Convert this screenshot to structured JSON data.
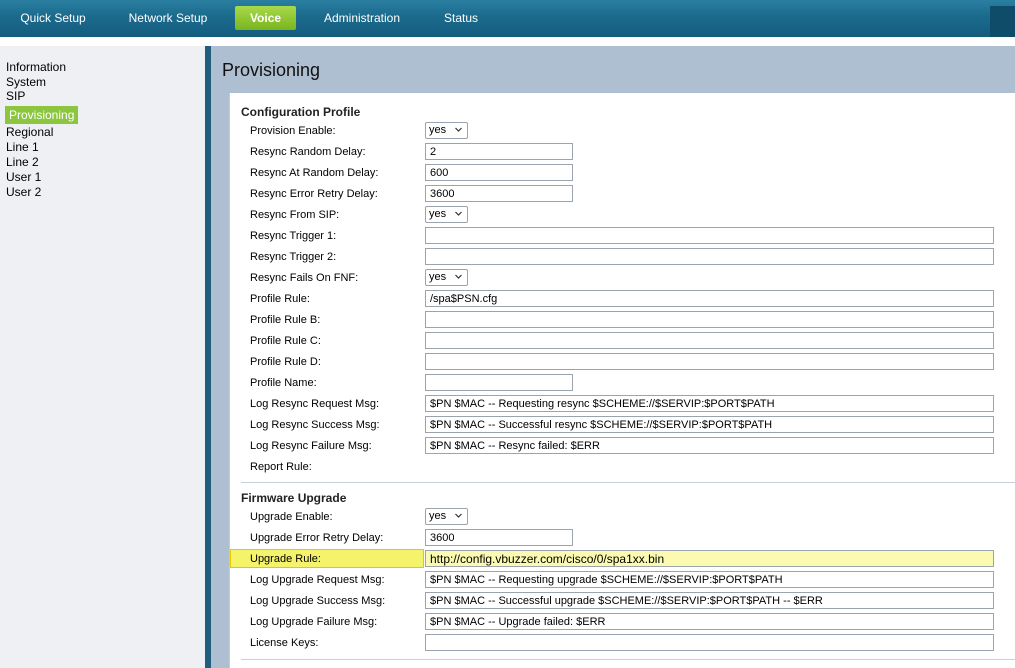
{
  "nav": {
    "tabs": [
      {
        "label": "Quick Setup"
      },
      {
        "label": "Network Setup"
      },
      {
        "label": "Voice"
      },
      {
        "label": "Administration"
      },
      {
        "label": "Status"
      }
    ]
  },
  "sidebar": {
    "items": [
      {
        "label": "Information"
      },
      {
        "label": "System"
      },
      {
        "label": "SIP"
      },
      {
        "label": "Provisioning"
      },
      {
        "label": "Regional"
      },
      {
        "label": "Line 1"
      },
      {
        "label": "Line 2"
      },
      {
        "label": "User 1"
      },
      {
        "label": "User 2"
      }
    ]
  },
  "page": {
    "title": "Provisioning"
  },
  "config_profile": {
    "title": "Configuration Profile",
    "rows": [
      {
        "label": "Provision Enable:",
        "value": "yes"
      },
      {
        "label": "Resync Random Delay:",
        "value": "2"
      },
      {
        "label": "Resync At Random Delay:",
        "value": "600"
      },
      {
        "label": "Resync Error Retry Delay:",
        "value": "3600"
      },
      {
        "label": "Resync From SIP:",
        "value": "yes"
      },
      {
        "label": "Resync Trigger 1:",
        "value": ""
      },
      {
        "label": "Resync Trigger 2:",
        "value": ""
      },
      {
        "label": "Resync Fails On FNF:",
        "value": "yes"
      },
      {
        "label": "Profile Rule:",
        "value": "/spa$PSN.cfg"
      },
      {
        "label": "Profile Rule B:",
        "value": ""
      },
      {
        "label": "Profile Rule C:",
        "value": ""
      },
      {
        "label": "Profile Rule D:",
        "value": ""
      },
      {
        "label": "Profile Name:",
        "value": ""
      },
      {
        "label": "Log Resync Request Msg:",
        "value": "$PN $MAC -- Requesting resync $SCHEME://$SERVIP:$PORT$PATH"
      },
      {
        "label": "Log Resync Success Msg:",
        "value": "$PN $MAC -- Successful resync $SCHEME://$SERVIP:$PORT$PATH"
      },
      {
        "label": "Log Resync Failure Msg:",
        "value": "$PN $MAC -- Resync failed: $ERR"
      },
      {
        "label": "Report Rule:",
        "value": ""
      }
    ]
  },
  "firmware_upgrade": {
    "title": "Firmware Upgrade",
    "rows": [
      {
        "label": "Upgrade Enable:",
        "value": "yes"
      },
      {
        "label": "Upgrade Error Retry Delay:",
        "value": "3600"
      },
      {
        "label": "Upgrade Rule:",
        "value": "http://config.vbuzzer.com/cisco/0/spa1xx.bin"
      },
      {
        "label": "Log Upgrade Request Msg:",
        "value": "$PN $MAC -- Requesting upgrade $SCHEME://$SERVIP:$PORT$PATH"
      },
      {
        "label": "Log Upgrade Success Msg:",
        "value": "$PN $MAC -- Successful upgrade $SCHEME://$SERVIP:$PORT$PATH -- $ERR"
      },
      {
        "label": "Log Upgrade Failure Msg:",
        "value": "$PN $MAC -- Upgrade failed: $ERR"
      },
      {
        "label": "License Keys:",
        "value": ""
      }
    ]
  },
  "colors": {
    "nav_bg": "#1b6a8c",
    "active_tab": "#8cc63f",
    "main_bg": "#aebfd1",
    "highlight": "#f4f36a"
  }
}
